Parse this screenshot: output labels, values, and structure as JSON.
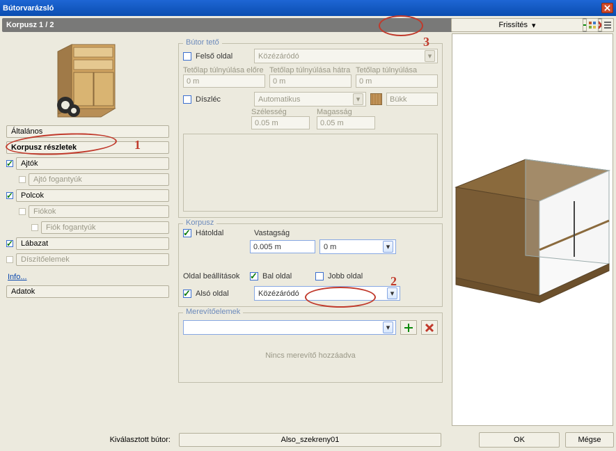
{
  "window": {
    "title": "Bútorvarázsló"
  },
  "subbar": {
    "title": "Korpusz 1 / 2"
  },
  "refresh": {
    "label": "Frissítés"
  },
  "sidebar": {
    "items": [
      {
        "label": "Általános"
      },
      {
        "label": "Korpusz részletek"
      },
      {
        "label": "Ajtók"
      },
      {
        "label": "Ajtó fogantyúk"
      },
      {
        "label": "Polcok"
      },
      {
        "label": "Fiókok"
      },
      {
        "label": "Fiók fogantyúk"
      },
      {
        "label": "Lábazat"
      },
      {
        "label": "Díszítőelemek"
      }
    ],
    "info": "Info...",
    "adatok": "Adatok"
  },
  "butor_teto": {
    "title": "Bútor tető",
    "felso_oldal": "Felső oldal",
    "kozez": "Közézáródó",
    "lbl_elore": "Tetőlap túlnyúlása előre",
    "lbl_hatra": "Tetőlap túlnyúlása hátra",
    "lbl_tul": "Tetőlap túlnyúlása",
    "v_elore": "0 m",
    "v_hatra": "0 m",
    "v_tul": "0 m",
    "diszlec": "Díszléc",
    "auto": "Automatikus",
    "bukk": "Bükk",
    "szel_lbl": "Szélesség",
    "mag_lbl": "Magasság",
    "szel": "0.05 m",
    "mag": "0.05 m"
  },
  "korpusz": {
    "title": "Korpusz",
    "hatoldal": "Hátoldal",
    "vast_lbl": "Vastagság",
    "vast": "0.005 m",
    "vast2": "0 m",
    "oldal_lbl": "Oldal beállítások",
    "bal": "Bal oldal",
    "jobb": "Jobb oldal",
    "also": "Alsó oldal",
    "also_combo": "Közézáródó"
  },
  "merevito": {
    "title": "Merevítőelemek",
    "empty": "Nincs merevítő hozzáadva"
  },
  "footer": {
    "label": "Kiválasztott bútor:",
    "value": "Also_szekreny01",
    "ok": "OK",
    "cancel": "Mégse"
  },
  "annotations": {
    "a1": "1",
    "a2": "2",
    "a3": "3"
  }
}
